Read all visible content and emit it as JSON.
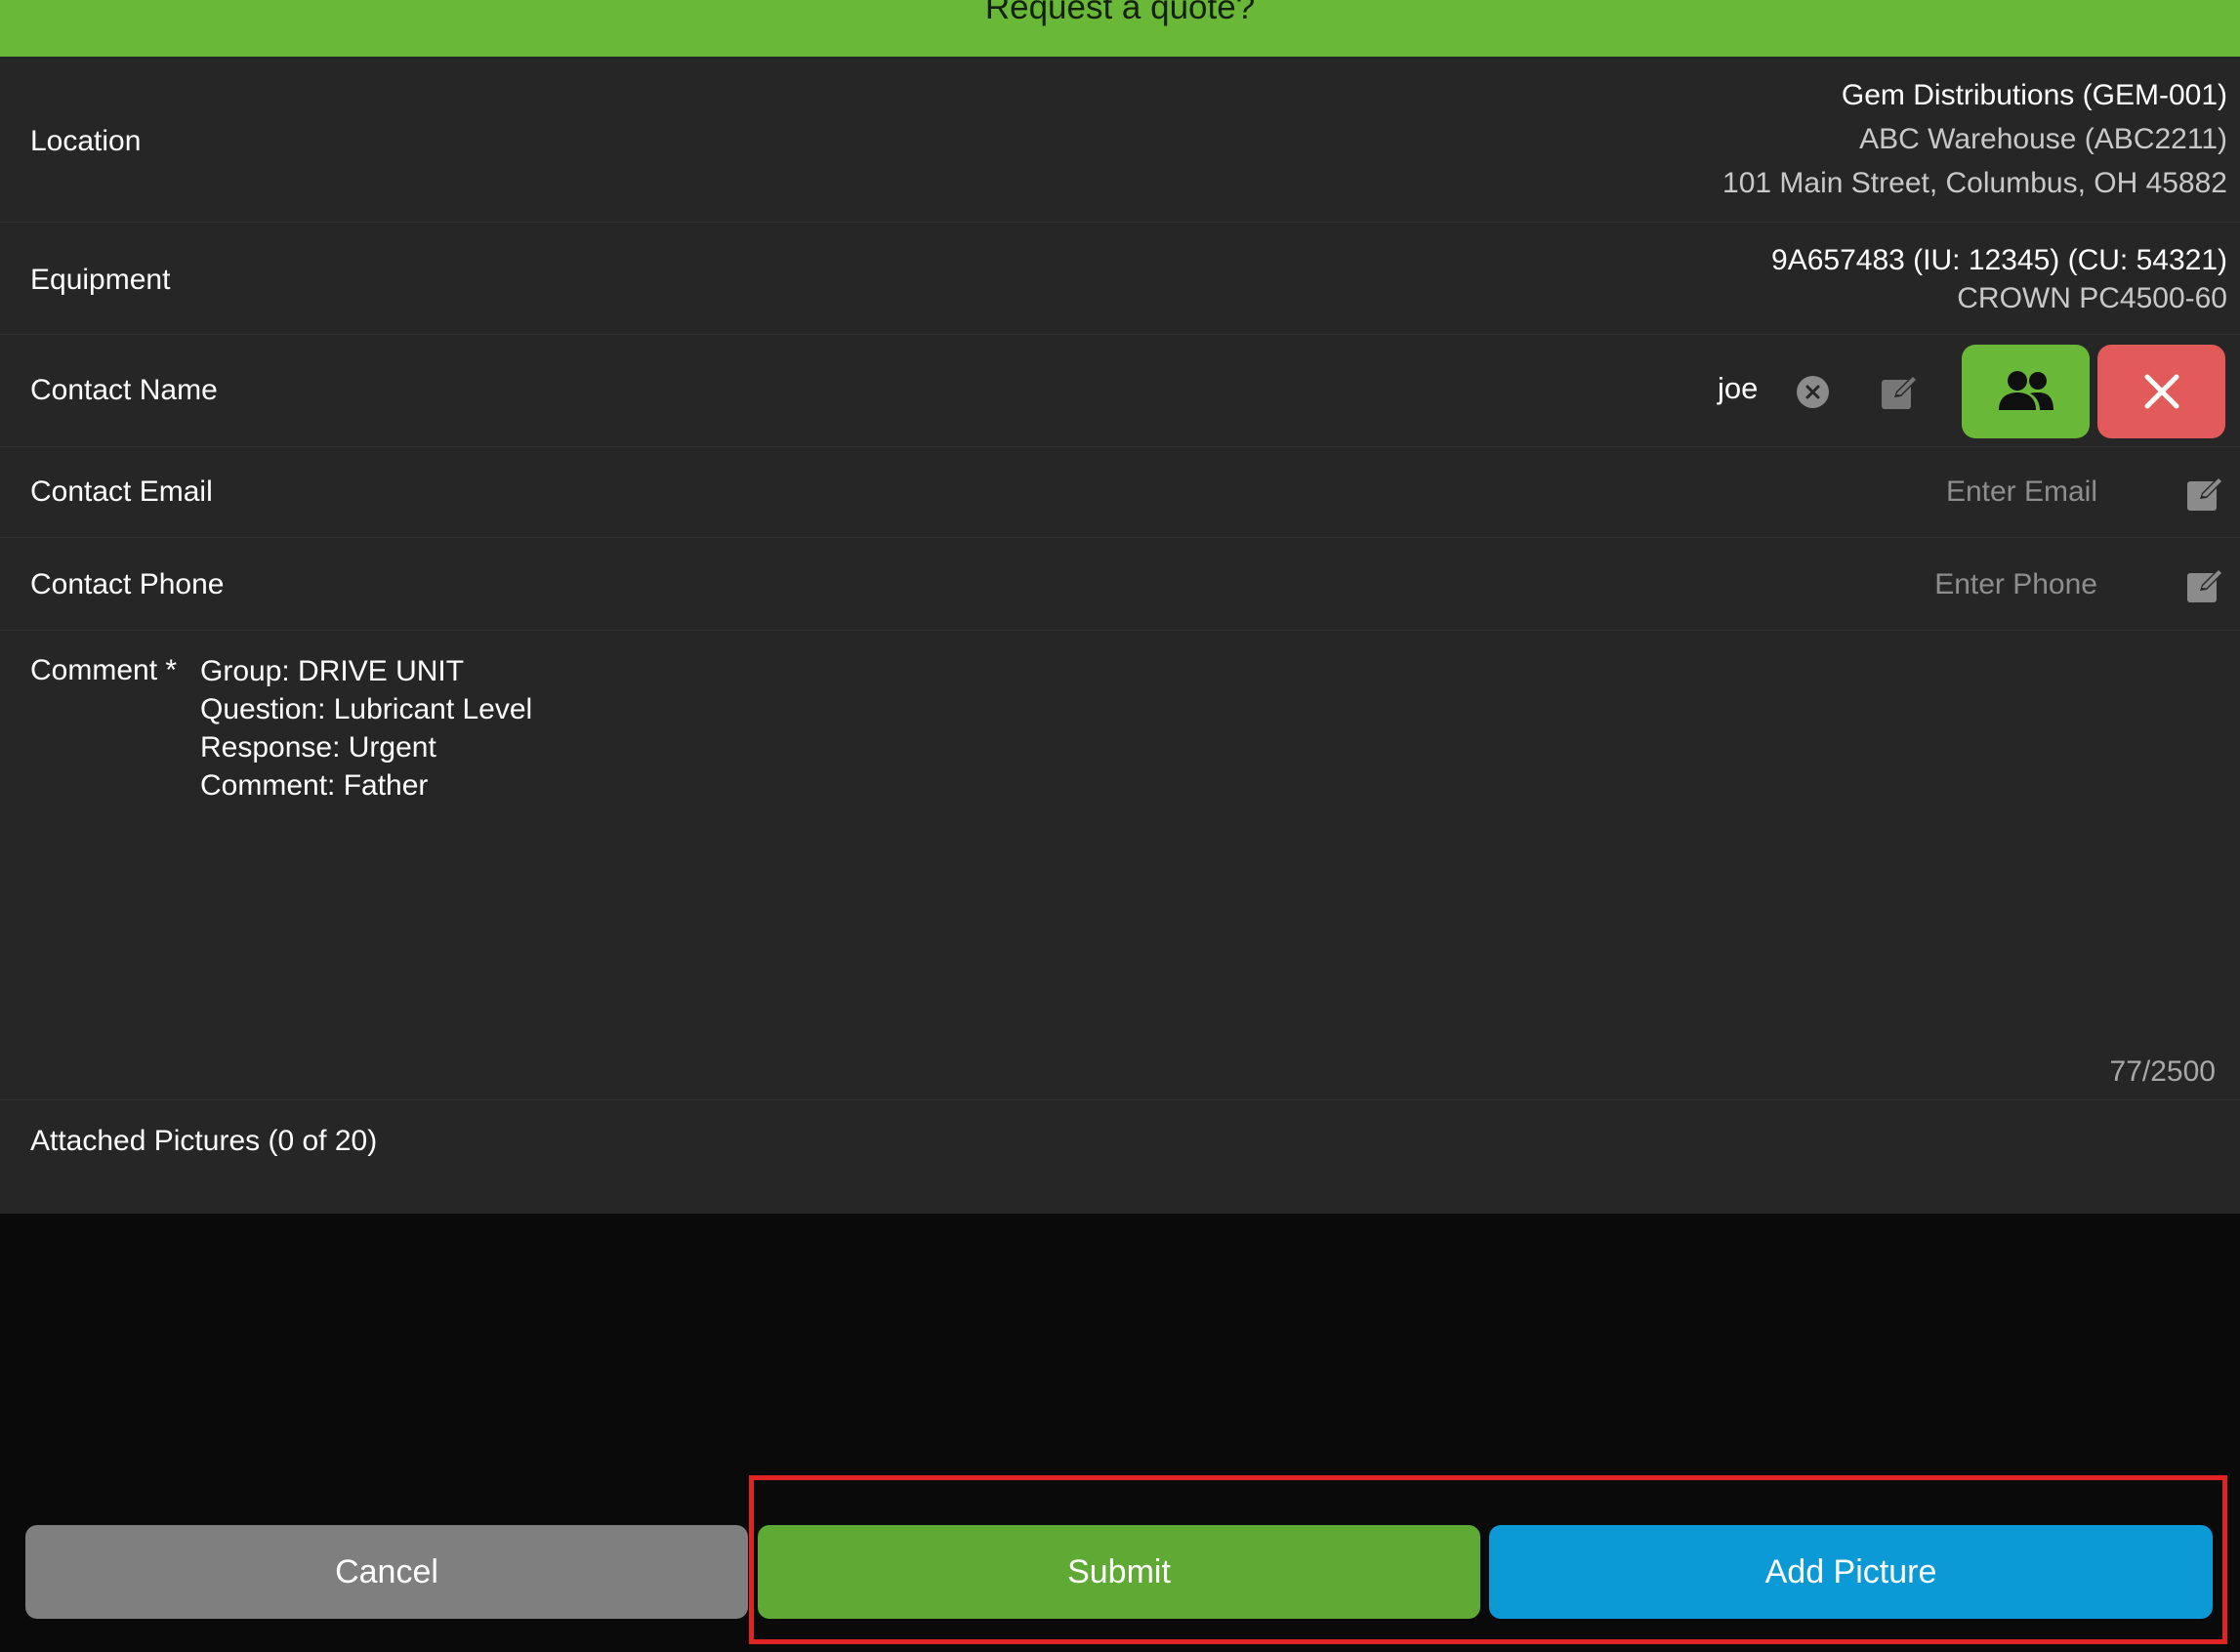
{
  "header": {
    "title": "Request a quote?",
    "bg_color": "#6ab838"
  },
  "form": {
    "location": {
      "label": "Location",
      "line1": "Gem Distributions (GEM-001)",
      "line2": "ABC Warehouse (ABC2211)",
      "line3": "101 Main Street, Columbus, OH 45882"
    },
    "equipment": {
      "label": "Equipment",
      "line1": "9A657483 (IU: 12345) (CU: 54321)",
      "line2": "CROWN PC4500-60"
    },
    "contact_name": {
      "label": "Contact Name",
      "value": "joe",
      "clear_icon": "clear-circle-icon",
      "edit_icon": "edit-icon",
      "contacts_icon": "people-icon",
      "remove_icon": "x-icon"
    },
    "contact_email": {
      "label": "Contact Email",
      "placeholder": "Enter Email",
      "edit_icon": "edit-icon"
    },
    "contact_phone": {
      "label": "Contact Phone",
      "placeholder": "Enter Phone",
      "edit_icon": "edit-icon"
    },
    "comment": {
      "label": "Comment *",
      "text": "Group: DRIVE UNIT\nQuestion: Lubricant Level\nResponse: Urgent\nComment: Father",
      "counter": "77/2500"
    },
    "attached_pictures": {
      "label": "Attached Pictures (0 of 20)"
    }
  },
  "buttons": {
    "cancel": "Cancel",
    "submit": "Submit",
    "add_picture": "Add Picture"
  },
  "colors": {
    "green": "#6ab838",
    "red": "#e25a5a",
    "blue": "#0b9ad6",
    "gray_button": "#7f7f7f",
    "highlight": "#e02424"
  }
}
